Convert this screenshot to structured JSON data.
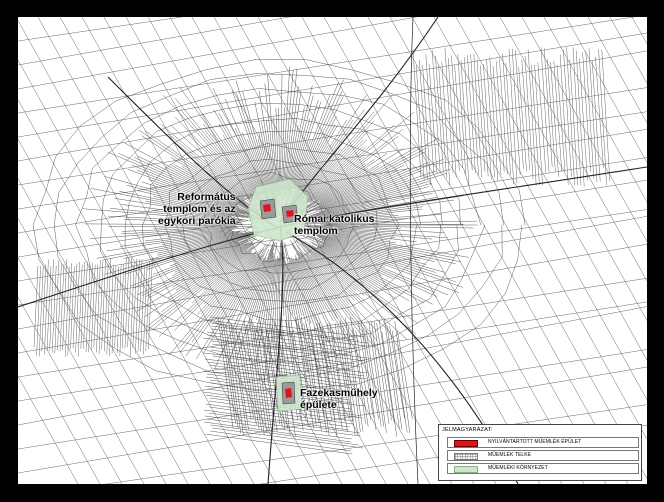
{
  "map": {
    "labels": {
      "reformed_church": [
        "Református",
        "templom és az",
        "egykori parókia"
      ],
      "catholic_church": [
        "Római katolikus",
        "templom"
      ],
      "pottery_workshop": [
        "Fazekasműhely",
        "épülete"
      ]
    },
    "legend": {
      "title": "JELMAGYARÁZAT:",
      "items": [
        {
          "text": "NYILVÁNTARTOTT MŰEMLÉK ÉPÜLET",
          "swatch": "red"
        },
        {
          "text": "MŰEMLÉK TELKE",
          "swatch": "grid"
        },
        {
          "text": "MŰEMLÉKI KÖRNYEZET",
          "swatch": "green"
        }
      ]
    },
    "colors": {
      "frame": "#000000",
      "background": "#ffffff",
      "parcel_lines": "#555555",
      "monument_building": "#e0141c",
      "monument_environment": "#cfe6cc"
    }
  }
}
